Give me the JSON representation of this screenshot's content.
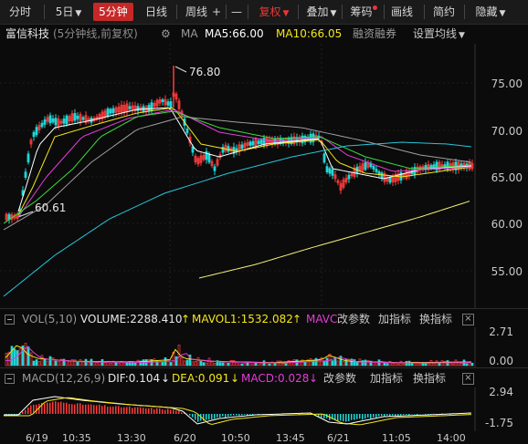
{
  "toolbar": {
    "items": [
      "分时",
      "5日",
      "5分钟",
      "日线",
      "周线",
      "+",
      "—",
      "复权",
      "叠加",
      "筹码",
      "画线",
      "简约",
      "隐藏"
    ],
    "active": "5分钟"
  },
  "header": {
    "stock_name": "富信科技",
    "period_note": "(5分钟线,前复权)",
    "ma_label": "MA",
    "ma5": "MA5:66.00",
    "ma10": "MA10:66.05",
    "margin_label": "融资融券",
    "setting_label": "设置均线"
  },
  "main_chart": {
    "y_ticks": [
      "75.00",
      "70.00",
      "65.00",
      "60.00",
      "55.00"
    ],
    "high_annotation": "76.80",
    "low_annotation": "60.61"
  },
  "volume_panel": {
    "title": "VOL(5,10)",
    "volume": "VOLUME:2288.410",
    "mavol1": "MAVOL1:1532.082",
    "mavc": "MAVC",
    "actions": [
      "改参数",
      "加指标",
      "换指标"
    ],
    "y_ticks": [
      "2.71",
      "0.00"
    ]
  },
  "macd_panel": {
    "title": "MACD(12,26,9)",
    "dif": "DIF:0.104",
    "dea": "DEA:0.091",
    "macd": "MACD:0.028",
    "actions": [
      "改参数",
      "加指标",
      "换指标"
    ],
    "y_ticks": [
      "2.94",
      "-1.75"
    ]
  },
  "x_axis": [
    "6/19",
    "10:35",
    "13:30",
    "6/20",
    "10:50",
    "13:45",
    "6/21",
    "11:05",
    "14:00"
  ],
  "colors": {
    "up": "#ff3b3b",
    "down": "#1fd8d8",
    "ma5": "#ffffff",
    "ma10": "#f5e61b",
    "ma20": "#e53bd9",
    "ma30": "#3ddc3d",
    "ma60": "#a0a0a0",
    "ma120": "#26c6da",
    "ma250": "#f5f07a",
    "accent": "#c62828"
  }
}
